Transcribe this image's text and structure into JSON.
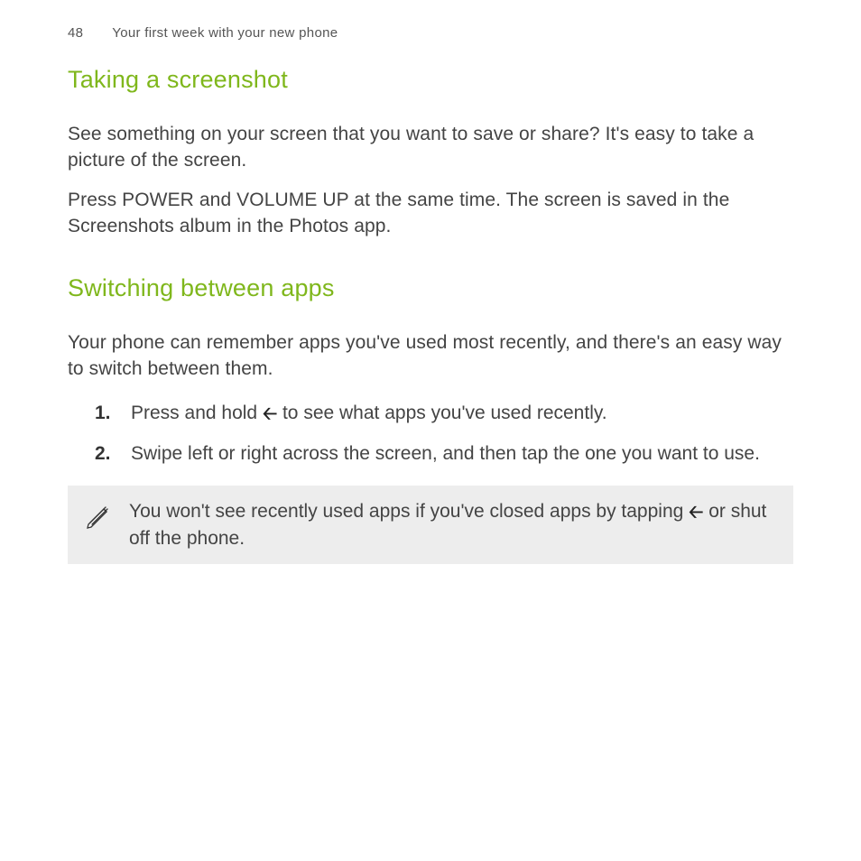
{
  "header": {
    "page_number": "48",
    "chapter": "Your first week with your new phone"
  },
  "section1": {
    "heading": "Taking a screenshot",
    "p1": "See something on your screen that you want to save or share? It's easy to take a picture of the screen.",
    "p2": "Press POWER and VOLUME UP at the same time. The screen is saved in the Screenshots album in the Photos app."
  },
  "section2": {
    "heading": "Switching between apps",
    "intro": "Your phone can remember apps you've used most recently, and there's an easy way to switch between them.",
    "steps": [
      {
        "num": "1.",
        "text_before": "Press and hold ",
        "icon": "back",
        "text_after": " to see what apps you've used recently."
      },
      {
        "num": "2.",
        "text_before": "Swipe left or right across the screen, and then tap the one you want to use.",
        "icon": "",
        "text_after": ""
      }
    ],
    "note": {
      "text_before": "You won't see recently used apps if you've closed apps by tapping ",
      "icon": "back",
      "text_after": " or shut off the phone."
    }
  }
}
